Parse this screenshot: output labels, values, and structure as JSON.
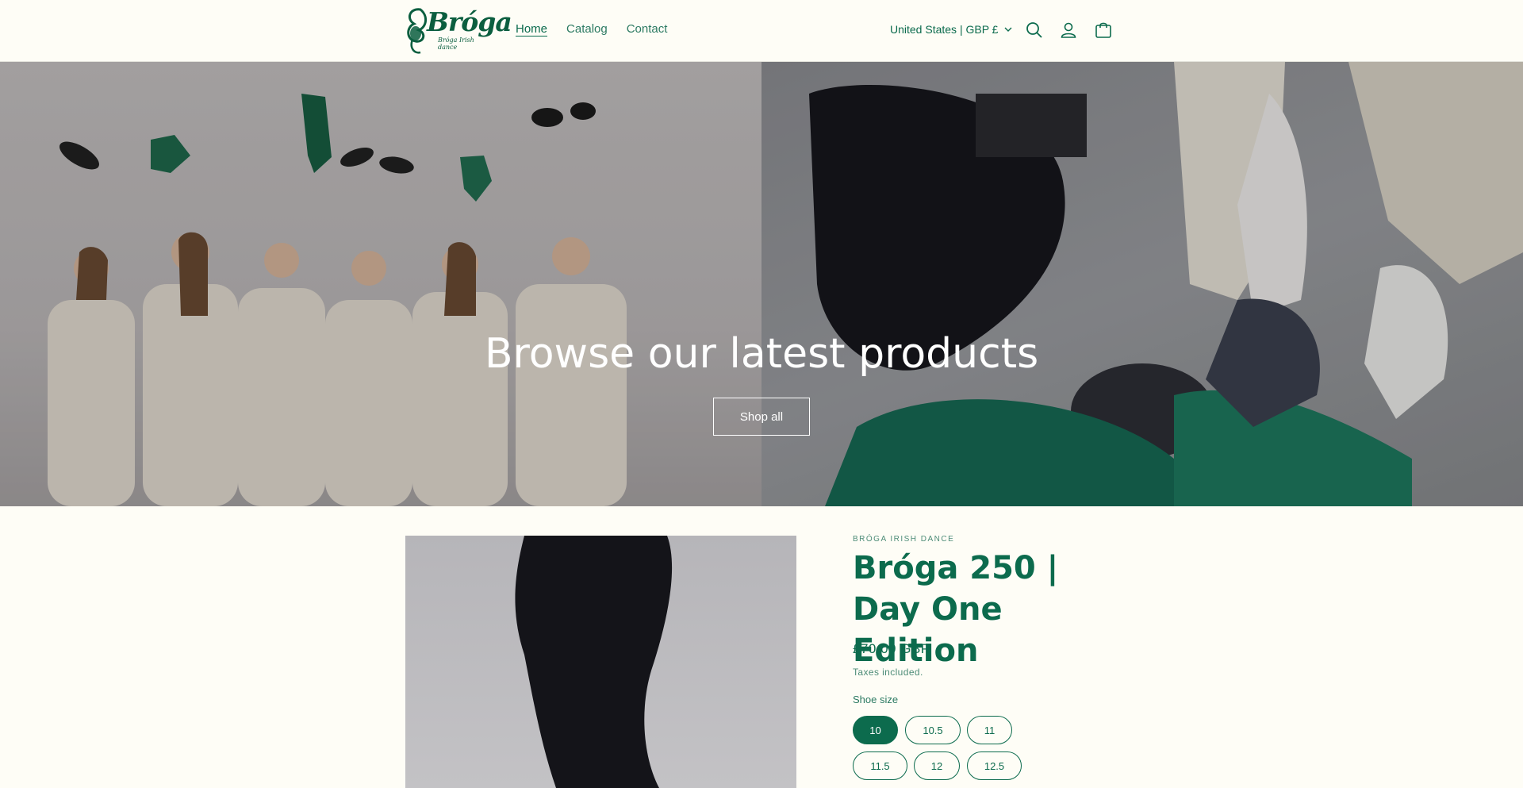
{
  "brand": {
    "name": "Bróga",
    "tagline": "Bróga Irish dance"
  },
  "nav": {
    "items": [
      {
        "label": "Home",
        "active": true
      },
      {
        "label": "Catalog",
        "active": false
      },
      {
        "label": "Contact",
        "active": false
      }
    ]
  },
  "header": {
    "country_selector": "United States | GBP £",
    "icons": [
      "search-icon",
      "account-icon",
      "cart-icon"
    ]
  },
  "hero": {
    "title": "Browse our latest products",
    "button_label": "Shop all"
  },
  "product": {
    "vendor": "BRÓGA IRISH DANCE",
    "title": "Bróga 250 | Day One Edition",
    "price": "£70.00 GBP",
    "tax_note": "Taxes included.",
    "size_label": "Shoe size",
    "sizes": [
      {
        "label": "10",
        "selected": true
      },
      {
        "label": "10.5",
        "selected": false
      },
      {
        "label": "11",
        "selected": false
      },
      {
        "label": "11.5",
        "selected": false
      },
      {
        "label": "12",
        "selected": false
      },
      {
        "label": "12.5",
        "selected": false
      }
    ]
  },
  "colors": {
    "brand_green": "#0c6b4d",
    "background": "#fefdf6"
  }
}
